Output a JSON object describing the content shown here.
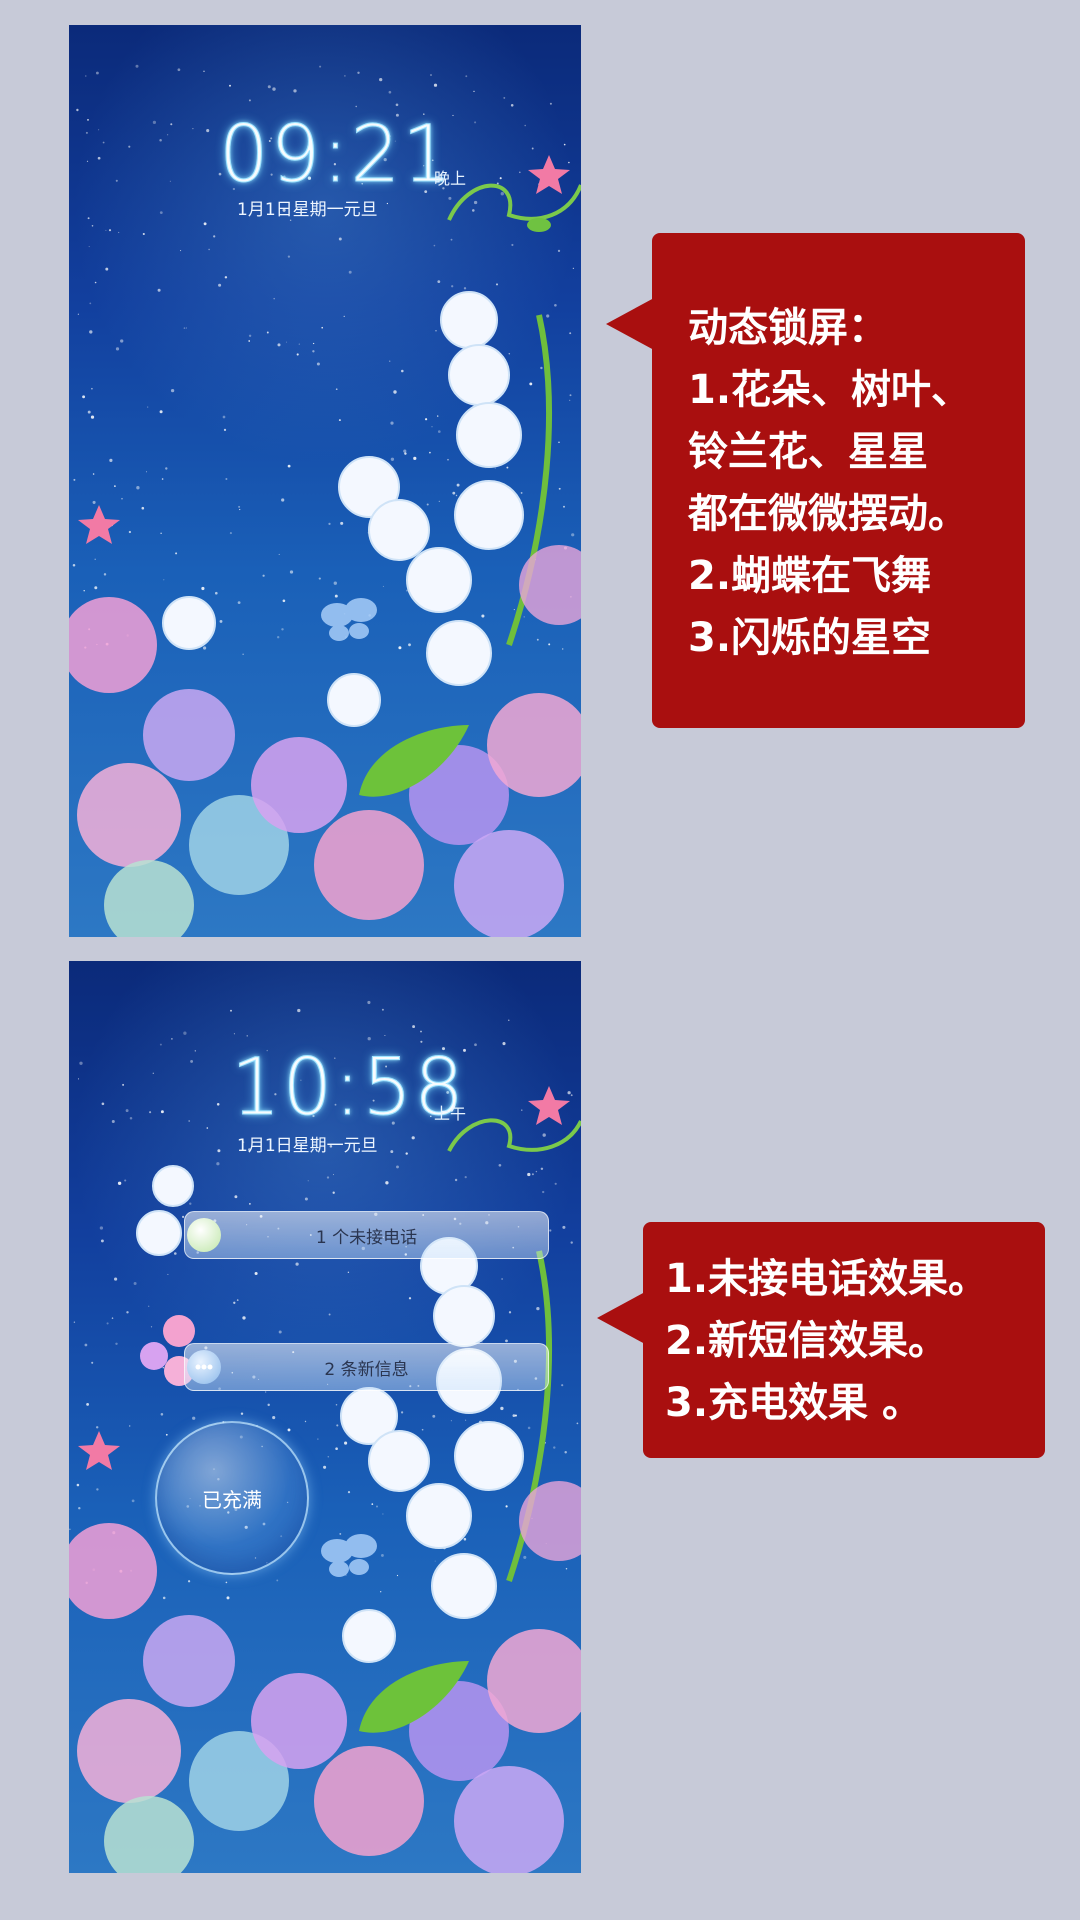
{
  "screens": [
    {
      "time": "09:21",
      "ampm": "晚上",
      "date": "1月1日星期一元旦"
    },
    {
      "time": "10:58",
      "ampm": "上午",
      "date": "1月1日星期一元旦",
      "notifications": [
        {
          "label": "1 个未接电话",
          "icon": "missed-call-icon"
        },
        {
          "label": "2 条新信息",
          "icon": "message-bubble-icon"
        }
      ],
      "charge_label": "已充满"
    }
  ],
  "callouts": [
    {
      "lines": [
        "动态锁屏：",
        "1.花朵、树叶、",
        "铃兰花、星星",
        "都在微微摆动。",
        "2.蝴蝶在飞舞",
        "3.闪烁的星空"
      ]
    },
    {
      "lines": [
        "1.未接电话效果。",
        "2.新短信效果。",
        "3.充电效果 。"
      ]
    }
  ],
  "colors": {
    "page_background": "#c7cad8",
    "callout_red": "#a90f0f",
    "sky_top": "#0b2a7a",
    "sky_bottom": "#2d78c4"
  }
}
